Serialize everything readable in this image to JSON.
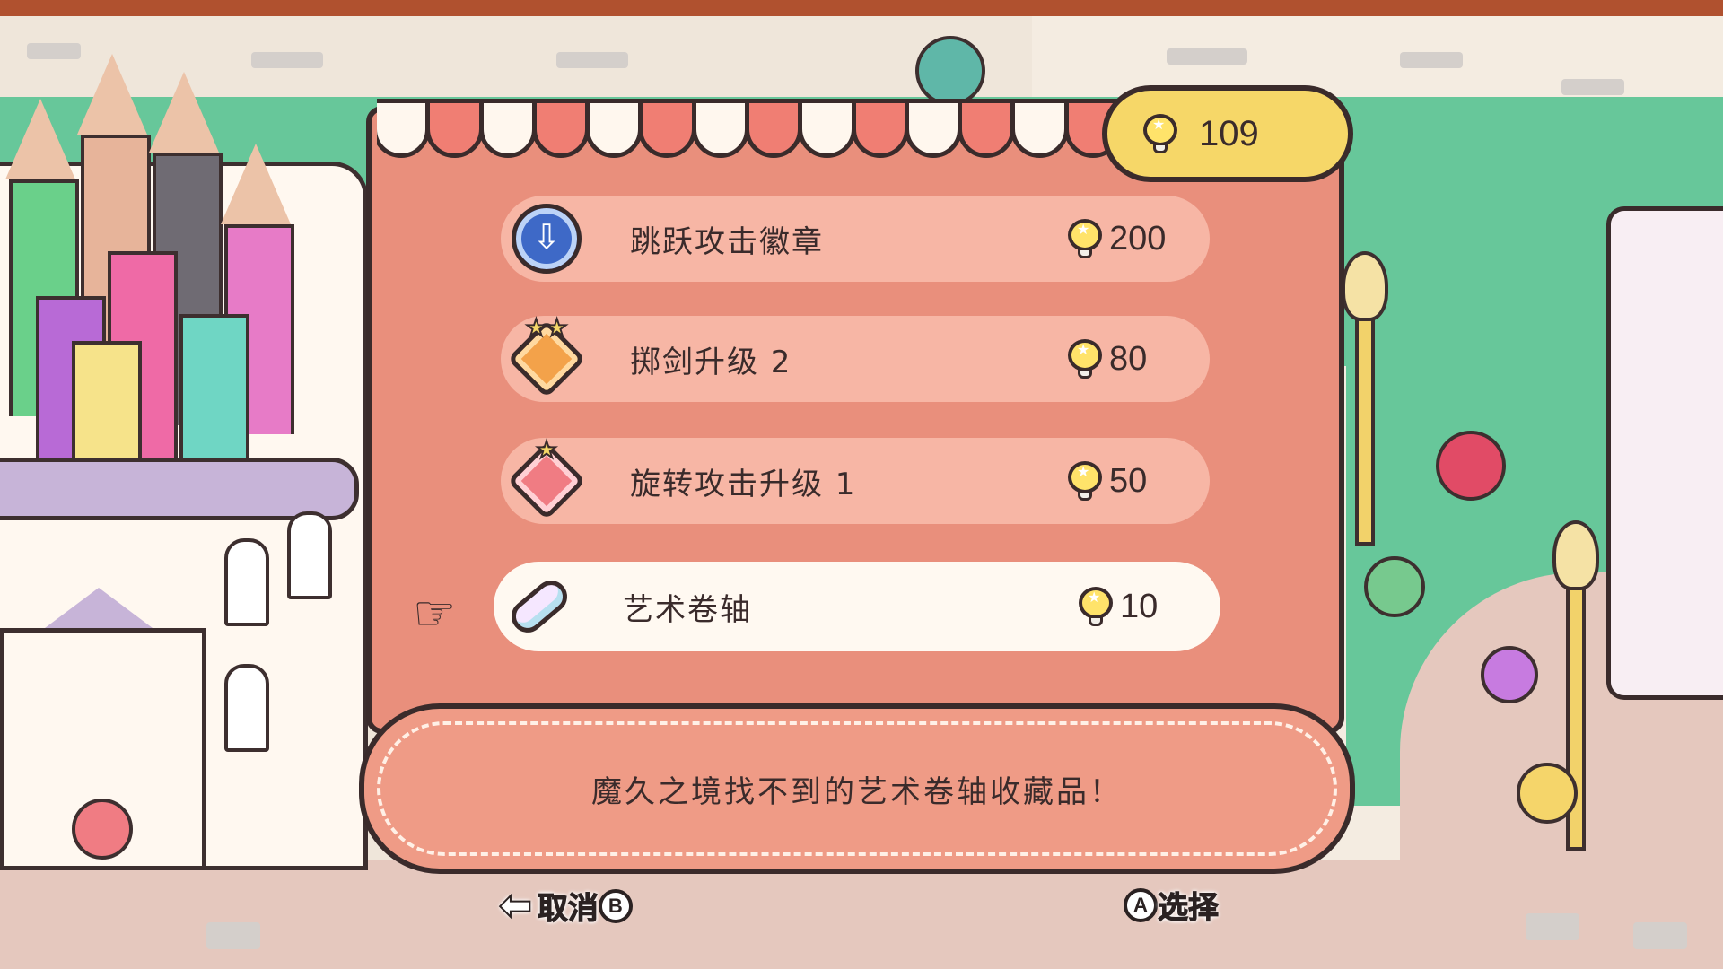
{
  "currency": {
    "icon": "lightbulb-icon",
    "value": "109"
  },
  "shop": {
    "items": [
      {
        "name": "跳跃攻击徽章",
        "price": "200",
        "icon": "jump-attack-badge-icon"
      },
      {
        "name": "掷剑升级 2",
        "price": "80",
        "icon": "sword-throw-upgrade-icon"
      },
      {
        "name": "旋转攻击升级 1",
        "price": "50",
        "icon": "spin-attack-upgrade-icon"
      },
      {
        "name": "艺术卷轴",
        "price": "10",
        "icon": "art-scroll-icon"
      }
    ],
    "selected_index": 3
  },
  "description": {
    "text": "魔久之境找不到的艺术卷轴收藏品！"
  },
  "hints": {
    "cancel_label": "取消",
    "cancel_button": "B",
    "select_label": "选择",
    "select_button": "A"
  },
  "colors": {
    "panel": "#e98f7c",
    "row": "#f7b6a5",
    "row_selected": "#fff9f1",
    "currency_pill": "#f6d768",
    "outline": "#3a2b2b"
  }
}
